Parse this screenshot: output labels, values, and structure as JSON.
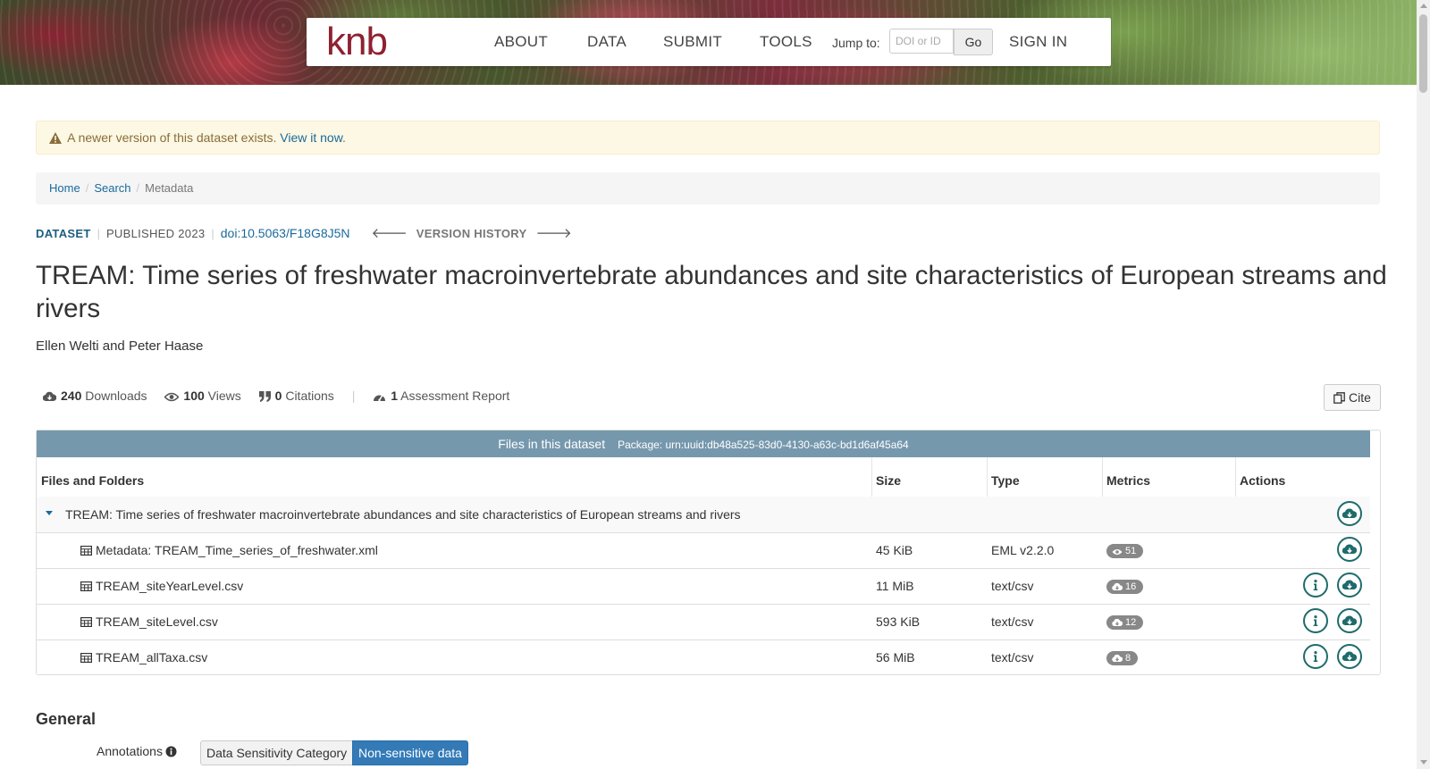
{
  "nav": {
    "logo": "knb",
    "items": [
      "ABOUT",
      "DATA",
      "SUBMIT",
      "TOOLS"
    ],
    "jump_label": "Jump to:",
    "jump_placeholder": "DOI or ID",
    "go_label": "Go",
    "sign_in": "SIGN IN"
  },
  "alert": {
    "text": "A newer version of this dataset exists.",
    "link": "View it now",
    "trailing": "."
  },
  "breadcrumb": [
    "Home",
    "Search",
    "Metadata"
  ],
  "meta": {
    "tag": "DATASET",
    "published": "PUBLISHED 2023",
    "doi": "doi:10.5063/F18G8J5N",
    "version_history": "VERSION HISTORY"
  },
  "title": "TREAM: Time series of freshwater macroinvertebrate abundances and site characteristics of European streams and rivers",
  "authors": "Ellen Welti and Peter Haase",
  "metrics": {
    "downloads_count": "240",
    "downloads_label": "Downloads",
    "views_count": "100",
    "views_label": "Views",
    "citations_count": "0",
    "citations_label": "Citations",
    "assessment_count": "1",
    "assessment_label": "Assessment Report",
    "cite_label": "Cite"
  },
  "files": {
    "header": "Files in this dataset",
    "package": "Package: urn:uuid:db48a525-83d0-4130-a63c-bd1d6af45a64",
    "columns": [
      "Files and Folders",
      "Size",
      "Type",
      "Metrics",
      "Actions"
    ],
    "package_row": "TREAM: Time series of freshwater macroinvertebrate abundances and site characteristics of European streams and rivers",
    "rows": [
      {
        "name": "Metadata: TREAM_Time_series_of_freshwater.xml",
        "size": "45 KiB",
        "type": "EML v2.2.0",
        "metric": "51",
        "metric_icon": "eye-icon"
      },
      {
        "name": "TREAM_siteYearLevel.csv",
        "size": "11 MiB",
        "type": "text/csv",
        "metric": "16",
        "metric_icon": "cloud-download-icon"
      },
      {
        "name": "TREAM_siteLevel.csv",
        "size": "593 KiB",
        "type": "text/csv",
        "metric": "12",
        "metric_icon": "cloud-download-icon"
      },
      {
        "name": "TREAM_allTaxa.csv",
        "size": "56 MiB",
        "type": "text/csv",
        "metric": "8",
        "metric_icon": "cloud-download-icon"
      }
    ]
  },
  "general": {
    "heading": "General",
    "annotations_label": "Annotations",
    "annotation_key": "Data Sensitivity Category",
    "annotation_value": "Non-sensitive data"
  },
  "colors": {
    "brand": "#8e2131",
    "link": "#1a6a9c",
    "table_header": "#7698ad",
    "action_ring": "#1f6b6b",
    "annotation_value_bg": "#337ab7"
  }
}
